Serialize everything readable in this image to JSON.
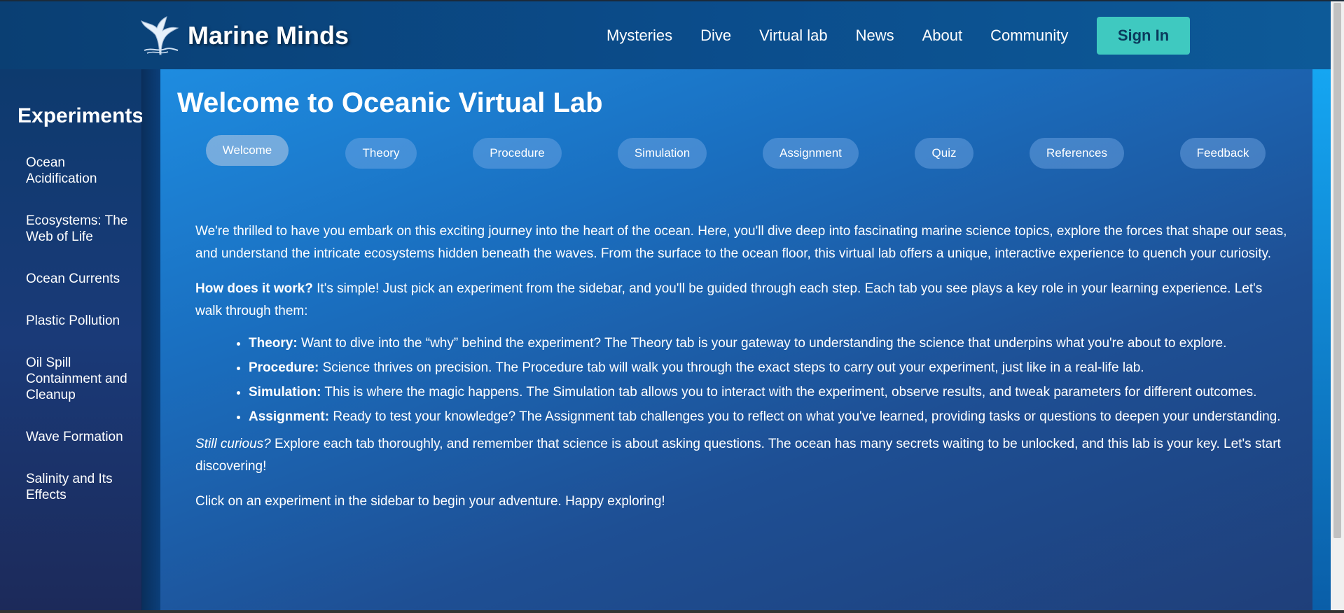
{
  "header": {
    "brand": "Marine Minds",
    "nav": [
      "Mysteries",
      "Dive",
      "Virtual lab",
      "News",
      "About",
      "Community"
    ],
    "signin": "Sign In"
  },
  "sidebar": {
    "title": "Experiments",
    "items": [
      "Ocean Acidification",
      "Ecosystems: The Web of Life",
      "Ocean Currents",
      "Plastic Pollution",
      "Oil Spill Containment and Cleanup",
      "Wave Formation",
      "Salinity and Its Effects"
    ]
  },
  "main": {
    "title": "Welcome to Oceanic Virtual Lab",
    "tabs": [
      "Welcome",
      "Theory",
      "Procedure",
      "Simulation",
      "Assignment",
      "Quiz",
      "References",
      "Feedback"
    ],
    "active_tab": "Welcome",
    "intro": "We're thrilled to have you embark on this exciting journey into the heart of the ocean. Here, you'll dive deep into fascinating marine science topics, explore the forces that shape our seas, and understand the intricate ecosystems hidden beneath the waves. From the surface to the ocean floor, this virtual lab offers a unique, interactive experience to quench your curiosity.",
    "how_bold": "How does it work?",
    "how_text": " It's simple! Just pick an experiment from the sidebar, and you'll be guided through each step. Each tab you see plays a key role in your learning experience. Let's walk through them:",
    "bullets": [
      {
        "label": "Theory:",
        "text": " Want to dive into the “why” behind the experiment? The Theory tab is your gateway to understanding the science that underpins what you're about to explore."
      },
      {
        "label": "Procedure:",
        "text": " Science thrives on precision. The Procedure tab will walk you through the exact steps to carry out your experiment, just like in a real-life lab."
      },
      {
        "label": "Simulation:",
        "text": " This is where the magic happens. The Simulation tab allows you to interact with the experiment, observe results, and tweak parameters for different outcomes."
      },
      {
        "label": "Assignment:",
        "text": " Ready to test your knowledge? The Assignment tab challenges you to reflect on what you've learned, providing tasks or questions to deepen your understanding."
      }
    ],
    "curious_italic": "Still curious?",
    "curious_text": " Explore each tab thoroughly, and remember that science is about asking questions. The ocean has many secrets waiting to be unlocked, and this lab is your key. Let's start discovering!",
    "closing": "Click on an experiment in the sidebar to begin your adventure. Happy exploring!"
  }
}
